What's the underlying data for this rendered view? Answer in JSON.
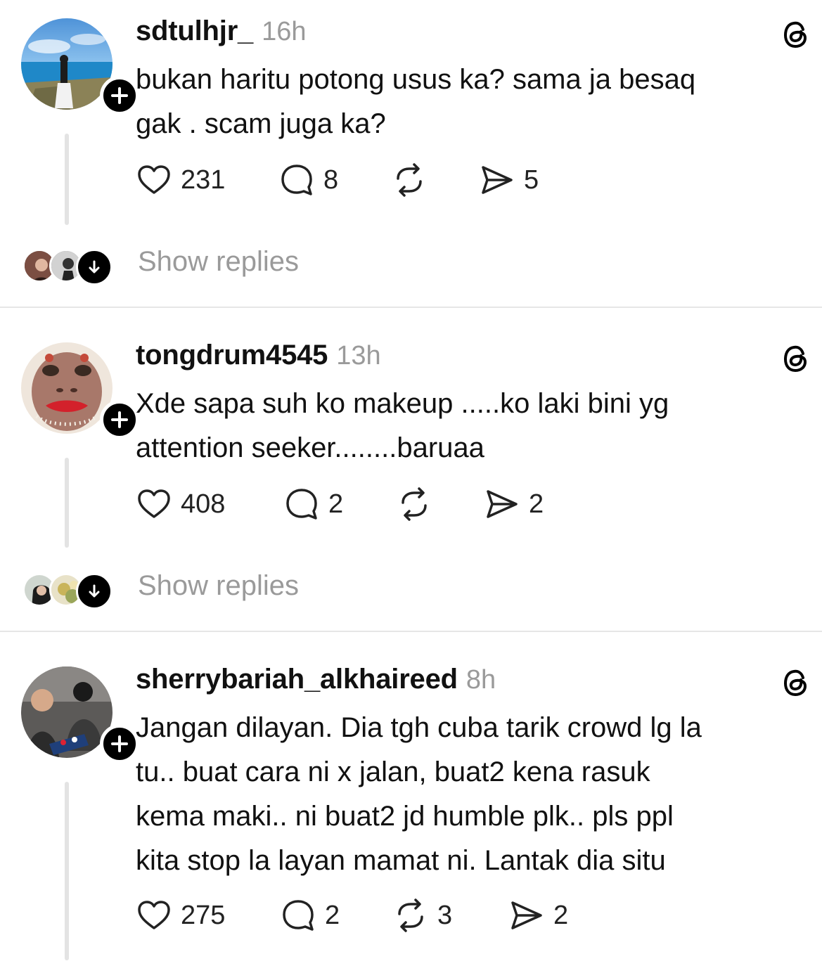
{
  "posts": [
    {
      "username": "sdtulhjr_",
      "time": "16h",
      "text_lines": [
        "bukan haritu potong usus ka?  sama ja besaq",
        "gak . scam juga ka?"
      ],
      "likes": "231",
      "comments": "8",
      "reposts": "",
      "shares": "5",
      "show_replies": "Show replies",
      "avatar_icon": "beach-landscape-photo"
    },
    {
      "username": "tongdrum4545",
      "time": "13h",
      "text_lines": [
        "Xde sapa suh ko makeup .....ko laki bini yg",
        "attention seeker........baruaa"
      ],
      "likes": "408",
      "comments": "2",
      "reposts": "",
      "shares": "2",
      "show_replies": "Show replies",
      "avatar_icon": "hippo-face-photo"
    },
    {
      "username": "sherrybariah_alkhaireed",
      "time": "8h",
      "text_lines": [
        "Jangan dilayan. Dia tgh cuba tarik crowd lg la",
        "tu.. buat cara ni x jalan, buat2 kena rasuk",
        "kema maki.. ni buat2 jd humble plk.. pls ppl",
        "kita stop la layan mamat ni. Lantak dia situ"
      ],
      "likes": "275",
      "comments": "2",
      "reposts": "3",
      "shares": "2",
      "show_replies": "",
      "avatar_icon": "people-group-photo"
    }
  ],
  "colors": {
    "text": "#111111",
    "muted": "#9a9a9a",
    "divider": "#e6e6e6",
    "thread_line": "#e3e3e3",
    "badge": "#000000"
  }
}
